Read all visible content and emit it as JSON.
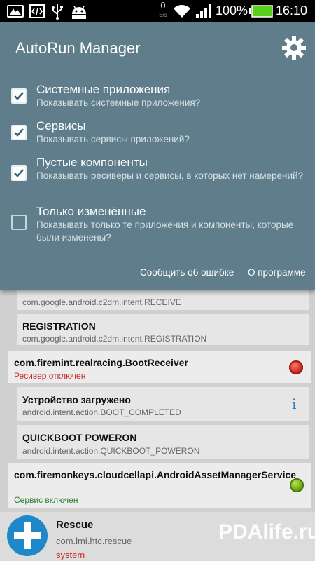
{
  "status_bar": {
    "data_rate": "0",
    "data_unit": "B/s",
    "battery_percent": "100%",
    "time": "16:10"
  },
  "header": {
    "title": "AutoRun Manager"
  },
  "options": [
    {
      "title": "Системные приложения",
      "description": "Показывать системные приложения?",
      "checked": true
    },
    {
      "title": "Сервисы",
      "description": "Показывать сервисы приложений?",
      "checked": true
    },
    {
      "title": "Пустые компоненты",
      "description": "Показывать ресиверы и сервисы, в которых нет намерений?",
      "checked": true
    },
    {
      "title": "Только изменённые",
      "description": "Показывать только те приложения и компоненты, которые были изменены?",
      "checked": false
    }
  ],
  "footer_links": {
    "report_bug": "Сообщить об ошибке",
    "about": "О программе"
  },
  "list": {
    "receive": {
      "intent": "com.google.android.c2dm.intent.RECEIVE"
    },
    "registration": {
      "name": "REGISTRATION",
      "intent": "com.google.android.c2dm.intent.REGISTRATION"
    },
    "realracing": {
      "name": "com.firemint.realracing.BootReceiver",
      "status": "Ресивер отключен",
      "status_color": "#c62828"
    },
    "boot_completed": {
      "name": "Устройство загружено",
      "intent": "android.intent.action.BOOT_COMPLETED"
    },
    "quickboot": {
      "name": "QUICKBOOT POWERON",
      "intent": "android.intent.action.QUICKBOOT_POWERON"
    },
    "cloudcell": {
      "name": "com.firemonkeys.cloudcellapi.AndroidAssetManagerService",
      "status": "Сервис включен",
      "status_color": "#2e7d32"
    },
    "rescue": {
      "name": "Rescue",
      "package": "com.lmi.htc.rescue",
      "type": "system"
    }
  },
  "watermark": "PDAlife.ru",
  "colors": {
    "panel": "#5f7d8b",
    "battery": "#5bd11c",
    "link_blue": "#2d7fc1"
  },
  "icons": [
    "screen-icon",
    "code-icon",
    "usb-icon",
    "android-icon",
    "wifi-icon",
    "signal-icon",
    "battery-icon",
    "gear-icon",
    "check-icon",
    "info-icon",
    "status-led-icon",
    "rescue-icon"
  ]
}
